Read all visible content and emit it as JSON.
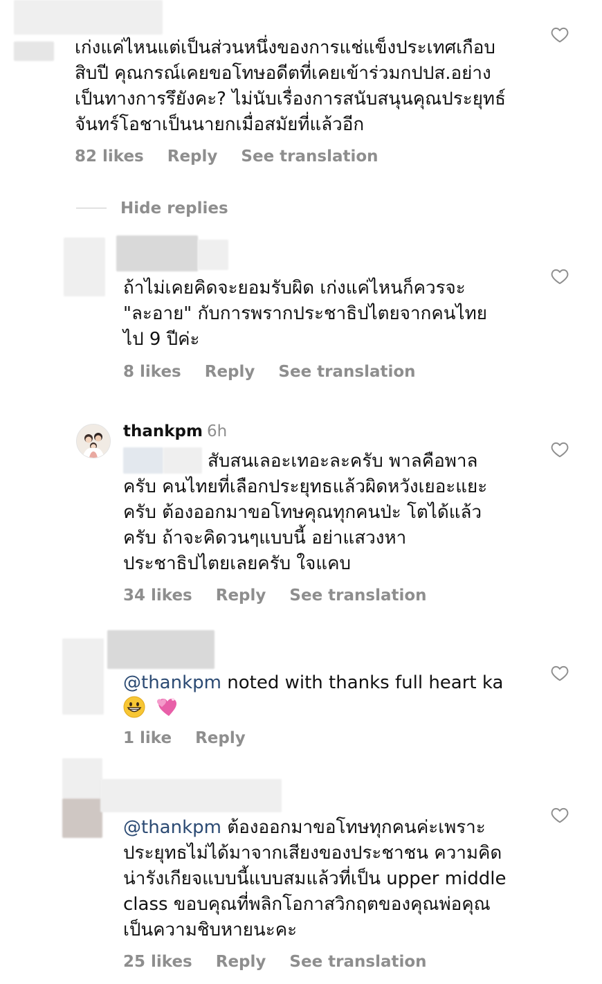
{
  "comments": [
    {
      "text_lines": [
        "เก่งแค่ไหนแต่เป็นส่วนหนึ่งของการแช่แข็งประเทศเกือบ",
        "สิบปี คุณกรณ์เคยขอโทษอดีตที่เคยเข้าร่วมกปปส.อย่าง",
        "เป็นทางการรึยังคะ? ไม่นับเรื่องการสนับสนุนคุณประยุทธ์",
        "จันทร์โอชาเป็นนายกเมื่อสมัยที่แล้วอีก"
      ],
      "likes": "82 likes",
      "reply": "Reply",
      "see_translation": "See translation"
    },
    {
      "text_lines": [
        "ถ้าไม่เคยคิดจะยอมรับผิด เก่งแค่ไหนก็ควรจะ",
        "\"ละอาย\" กับการพรากประชาธิปไตยจากคนไทย",
        "ไป 9 ปีค่ะ"
      ],
      "likes": "8 likes",
      "reply": "Reply",
      "see_translation": "See translation"
    },
    {
      "username": "thankpm",
      "time": "6h",
      "text_lines": [
        "สับสนเลอะเทอะละครับ พาลคือพาล",
        "ครับ คนไทยที่เลือกประยุทธแล้วผิดหวังเยอะแยะ",
        "ครับ ต้องออกมาขอโทษคุณทุกคนป่ะ โตได้แล้ว",
        "ครับ ถ้าจะคิดวนๆแบบนี้ อย่าแสวงหา",
        "ประชาธิปไตยเลยครับ ใจแคบ"
      ],
      "likes": "34 likes",
      "reply": "Reply",
      "see_translation": "See translation"
    },
    {
      "mention": "@thankpm",
      "text_rest": " noted with thanks full heart ka",
      "emojis": [
        "grinning-face",
        "revolving-hearts"
      ],
      "likes": "1 like",
      "reply": "Reply"
    },
    {
      "mention": "@thankpm",
      "first_line_rest": " ต้องออกมาขอโทษทุกคนค่ะเพราะ",
      "text_lines": [
        "ประยุทธไม่ได้มาจากเสียงของประชาชน ความคิด",
        "น่ารังเกียจแบบนี้แบบสมแล้วที่เป็น upper middle",
        "class ขอบคุณที่พลิกโอกาสวิกฤตของคุณพ่อคุณ",
        "เป็นความชิบหายนะคะ"
      ],
      "likes": "25 likes",
      "reply": "Reply",
      "see_translation": "See translation"
    }
  ],
  "hide_replies": "Hide replies",
  "colors": {
    "text": "#111111",
    "meta": "#8e8e8e",
    "mention": "#2b4a73",
    "background": "#ffffff"
  },
  "icons": [
    "heart-outline-icon"
  ]
}
